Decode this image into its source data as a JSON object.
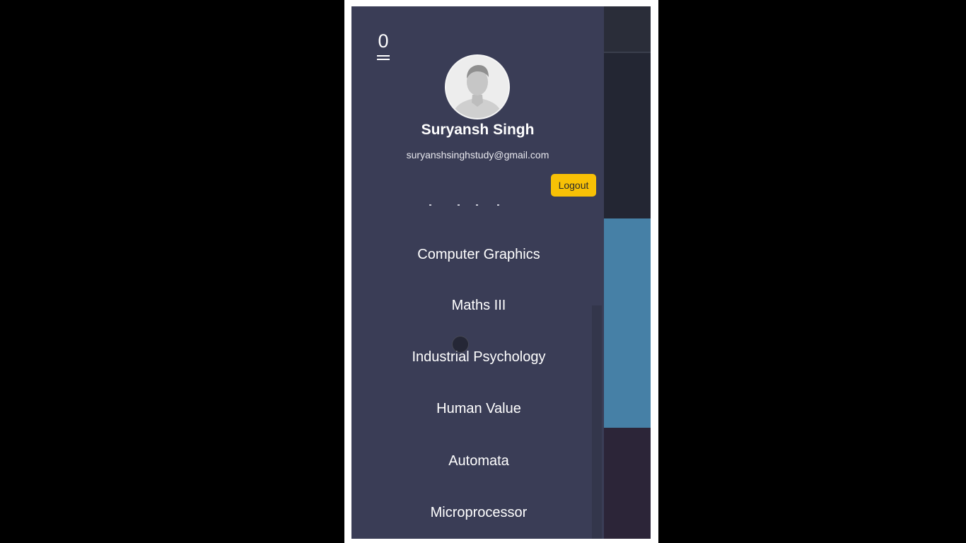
{
  "drawer": {
    "menu_count": "0",
    "user": {
      "name": "Suryansh Singh",
      "email": "suryanshsinghstudy@gmail.com"
    },
    "logout_label": "Logout",
    "items": [
      {
        "label": "Computer Graphics"
      },
      {
        "label": "Maths III"
      },
      {
        "label": "Industrial Psychology"
      },
      {
        "label": "Human Value"
      },
      {
        "label": "Automata"
      },
      {
        "label": "Microprocessor"
      }
    ]
  },
  "colors": {
    "drawer_bg": "#3a3d56",
    "logout_bg": "#f8c106",
    "accent_blue": "#4680a6"
  },
  "icons": {
    "menu": "hamburger-icon",
    "avatar": "default-user-avatar-icon"
  }
}
